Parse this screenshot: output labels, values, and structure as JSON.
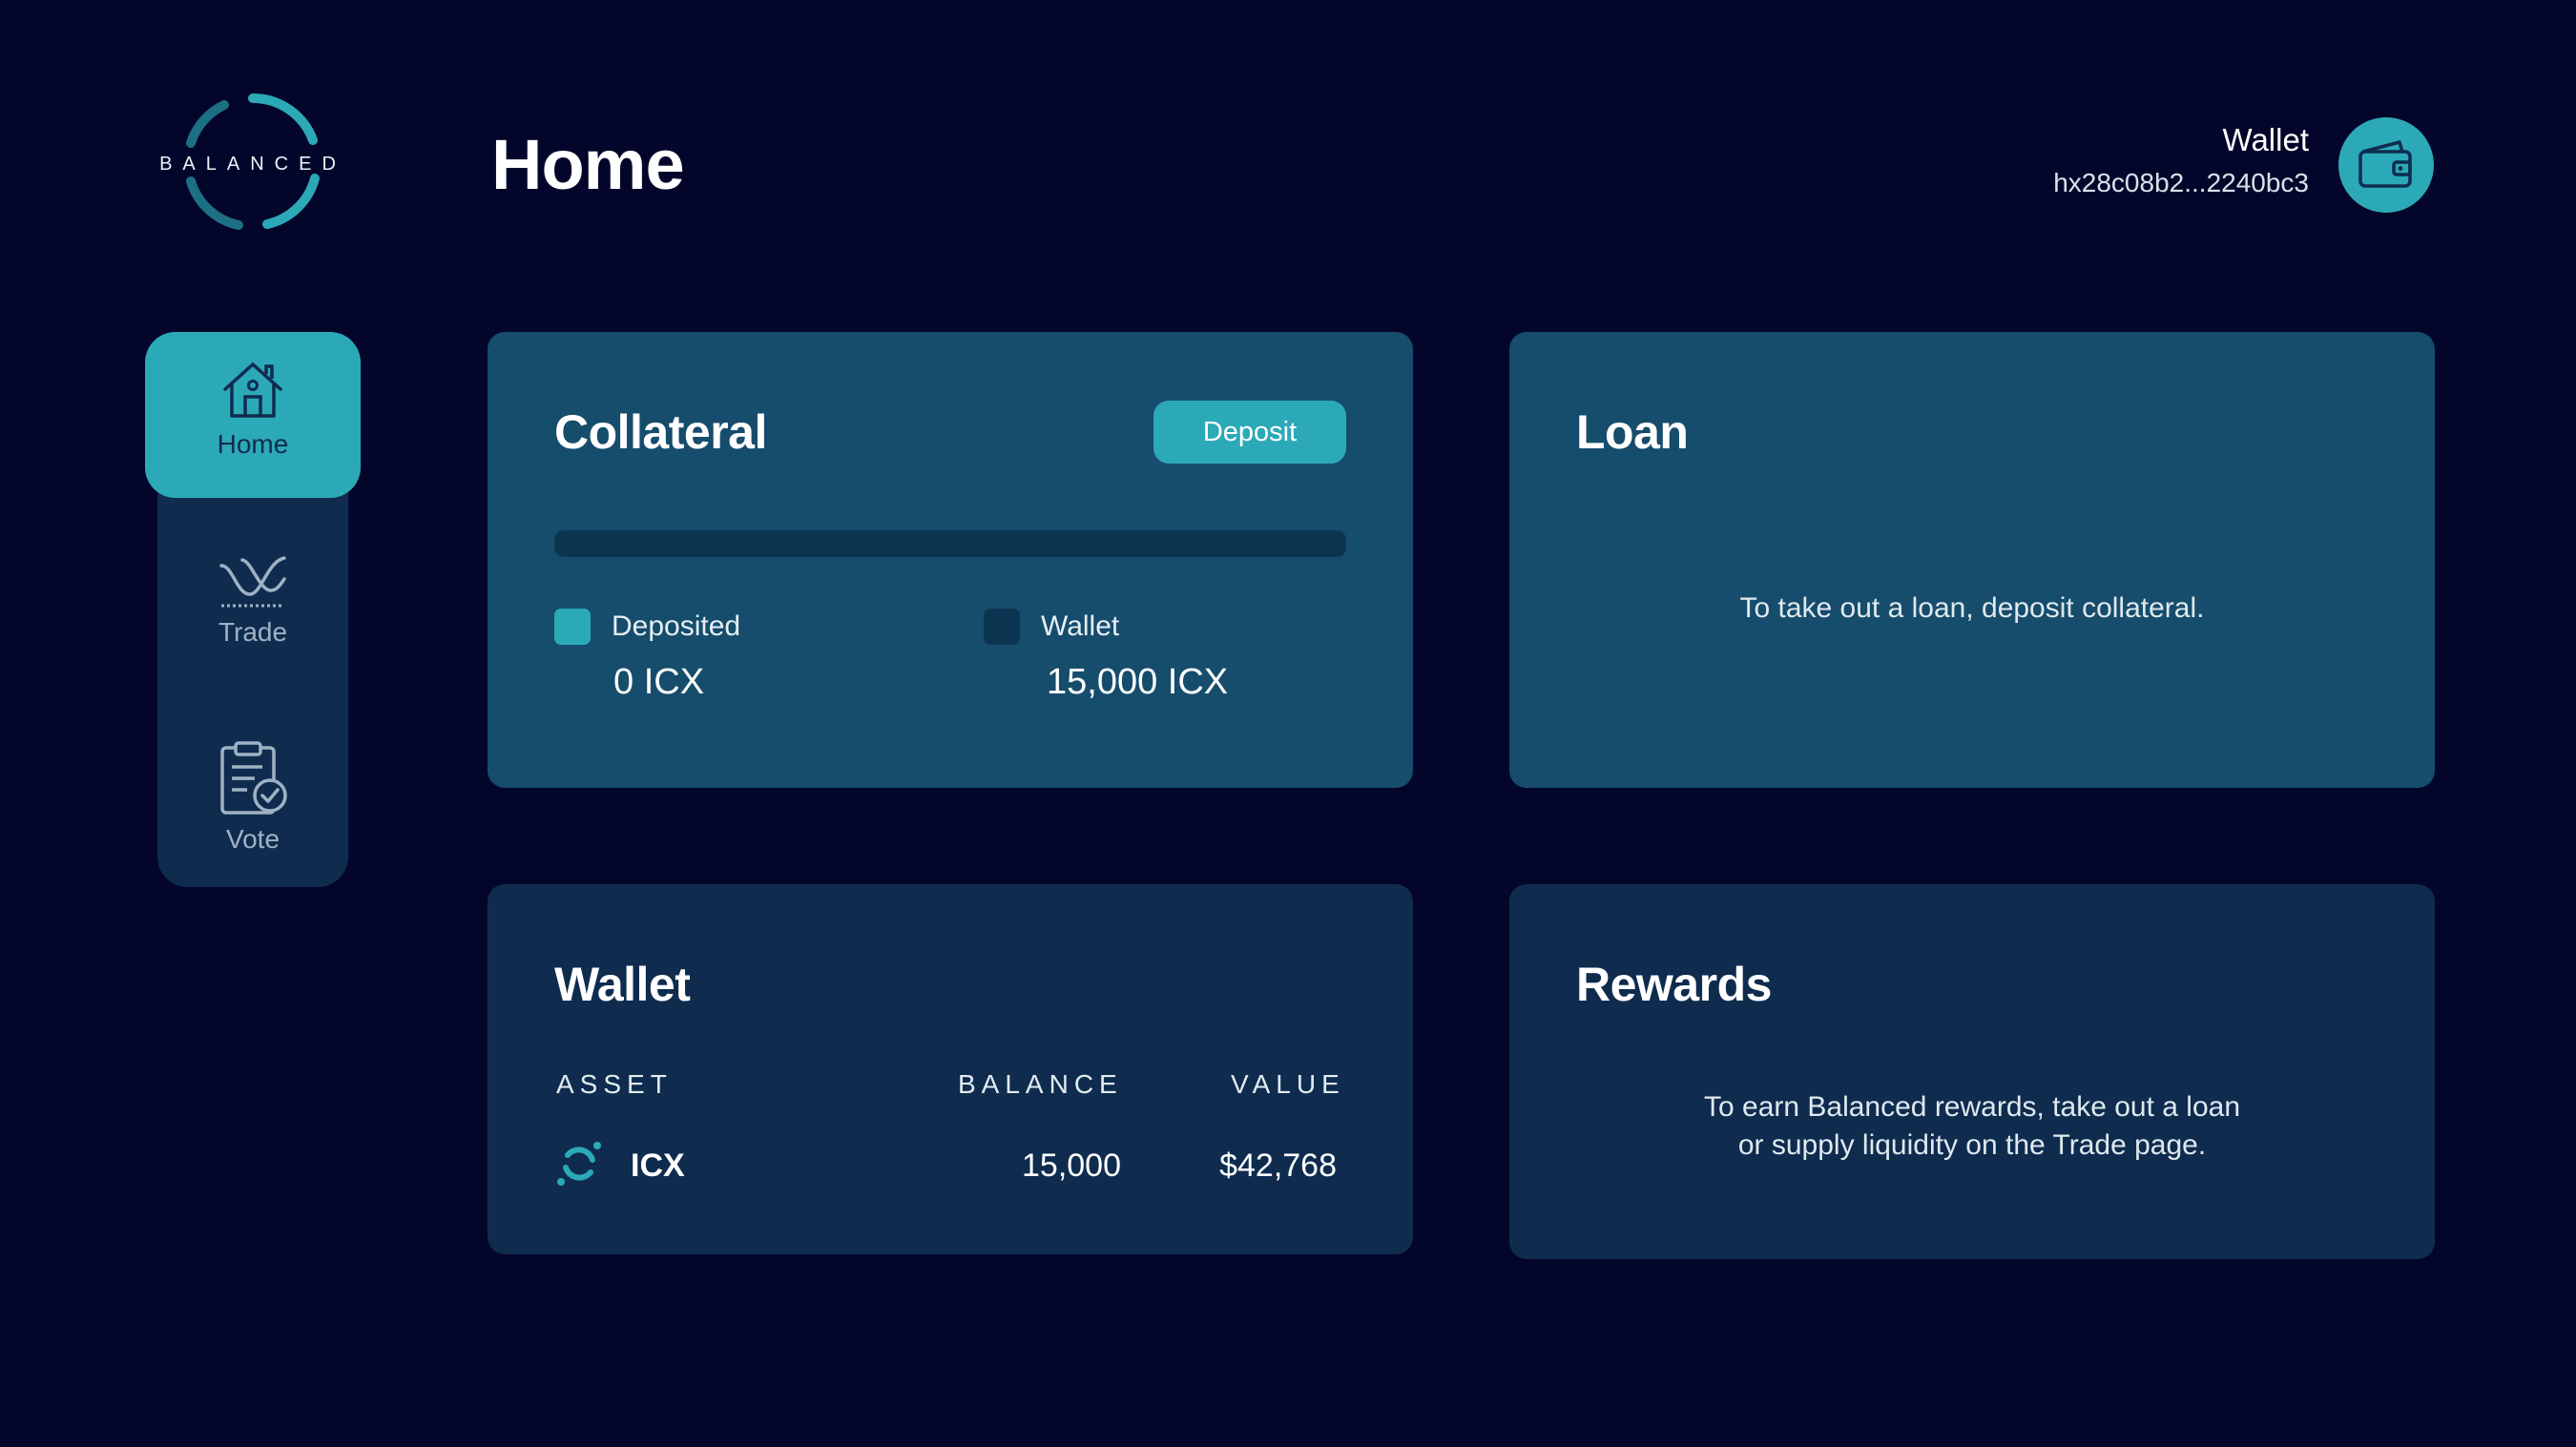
{
  "brand": {
    "logo_text": "BALANCED"
  },
  "header": {
    "title": "Home",
    "wallet": {
      "label": "Wallet",
      "address": "hx28c08b2...2240bc3"
    }
  },
  "sidebar": {
    "items": [
      {
        "label": "Home",
        "icon": "home-icon",
        "active": true
      },
      {
        "label": "Trade",
        "icon": "trade-icon",
        "active": false
      },
      {
        "label": "Vote",
        "icon": "vote-icon",
        "active": false
      }
    ]
  },
  "collateral": {
    "title": "Collateral",
    "deposit_label": "Deposit",
    "deposited_fraction": 0,
    "legend": [
      {
        "label": "Deposited",
        "value": "0 ICX",
        "color": "#2ca9b7"
      },
      {
        "label": "Wallet",
        "value": "15,000 ICX",
        "color": "#0b3450"
      }
    ]
  },
  "loan": {
    "title": "Loan",
    "message": "To take out a loan, deposit collateral."
  },
  "wallet": {
    "title": "Wallet",
    "columns": [
      "ASSET",
      "BALANCE",
      "VALUE"
    ],
    "rows": [
      {
        "asset": "ICX",
        "balance": "15,000",
        "value": "$42,768"
      }
    ]
  },
  "rewards": {
    "title": "Rewards",
    "message_line1": "To earn Balanced rewards, take out a loan",
    "message_line2": "or supply liquidity on the Trade page."
  },
  "colors": {
    "background": "#03062a",
    "accent": "#2ca9b7",
    "card_light": "#164c6c",
    "card_dark": "#0f2c4f"
  }
}
